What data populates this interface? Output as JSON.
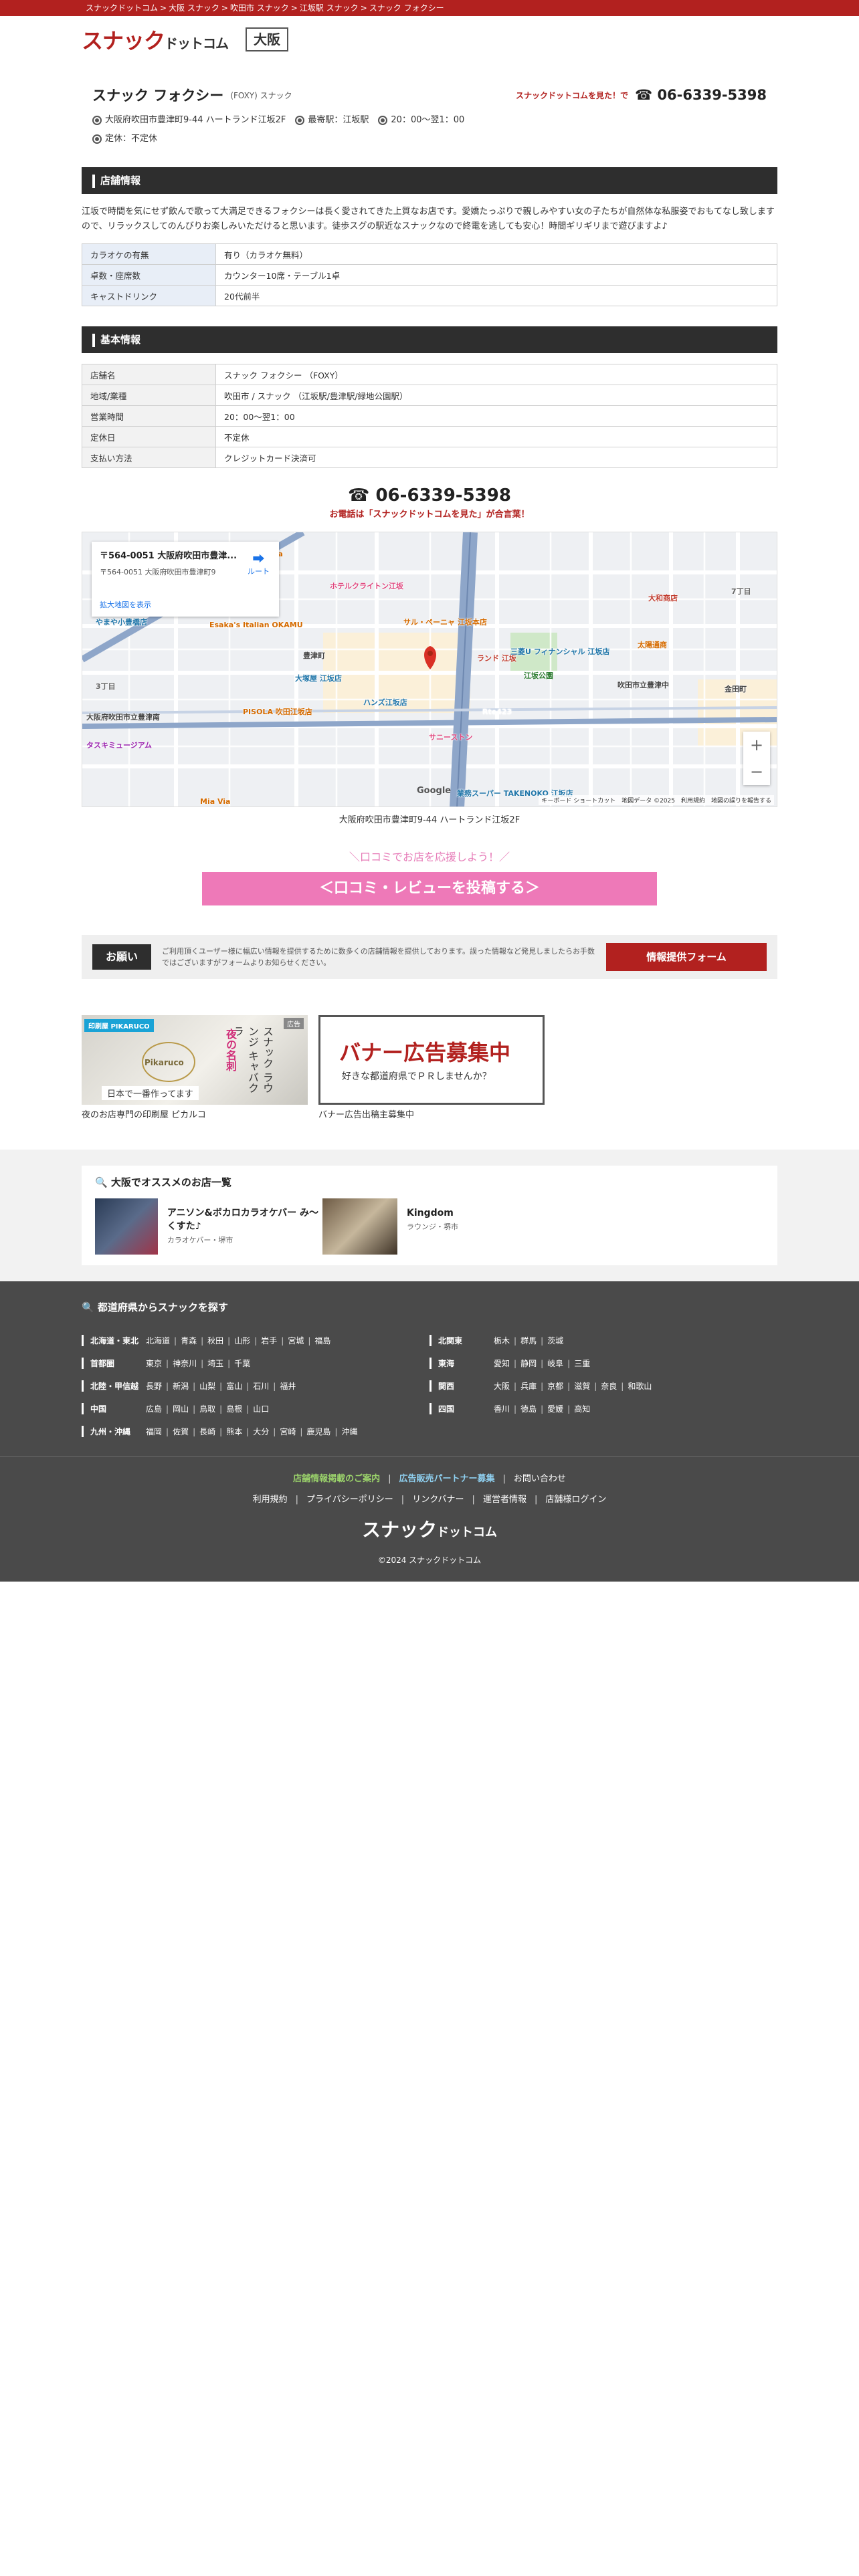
{
  "breadcrumb": [
    "スナックドットコム",
    "大阪 スナック",
    "吹田市 スナック",
    "江坂駅 スナック",
    "スナック フォクシー"
  ],
  "breadcrumb_sep": ">",
  "header": {
    "logo_main": "スナック",
    "logo_sub": "ドットコム",
    "area": "大阪"
  },
  "shop": {
    "name": "スナック フォクシー",
    "sub": "(FOXY) スナック",
    "tel_note": "スナックドットコムを見た！で",
    "tel_icon": "☎",
    "tel": "06-6339-5398",
    "meta": [
      "大阪府吹田市豊津町9-44 ハートランド江坂2F",
      "最寄駅：江坂駅",
      "20：00〜翌1：00",
      "定休：不定休"
    ]
  },
  "store_info": {
    "title": "店舗情報",
    "description": "江坂で時間を気にせず飲んで歌って大満足できるフォクシーは長く愛されてきた上質なお店です。愛嬌たっぷりで親しみやすい女の子たちが自然体な私服姿でおもてなし致しますので、リラックスしてのんびりお楽しみいただけると思います。徒歩スグの駅近なスナックなので終電を逃しても安心！時間ギリギリまで遊びますよ♪",
    "rows": [
      {
        "k": "カラオケの有無",
        "v": "有り（カラオケ無料）"
      },
      {
        "k": "卓数・座席数",
        "v": "カウンター10席・テーブル1卓"
      },
      {
        "k": "キャストドリンク",
        "v": "20代前半"
      }
    ]
  },
  "basic_info": {
    "title": "基本情報",
    "rows": [
      {
        "k": "店舗名",
        "v": "スナック フォクシー （FOXY）"
      },
      {
        "k": "地域/業種",
        "v": "吹田市 / スナック （江坂駅/豊津駅/緑地公園駅）"
      },
      {
        "k": "営業時間",
        "v": "20：00〜翌1：00"
      },
      {
        "k": "定休日",
        "v": "不定休"
      },
      {
        "k": "支払い方法",
        "v": "クレジットカード決済可"
      }
    ]
  },
  "big_tel": {
    "icon": "☎",
    "number": "06-6339-5398",
    "note": "お電話は「スナックドットコムを見た」が合言葉！"
  },
  "map": {
    "card_title": "〒564-0051 大阪府吹田市豊津...",
    "card_address": "〒564-0051 大阪府吹田市豊津町9",
    "card_link": "拡大地図を表示",
    "route": "ルート",
    "zoom_in": "+",
    "zoom_out": "−",
    "google": "Google",
    "footer": "キーボード ショートカット　地図データ ©2025　利用規約　地図の誤りを報告する",
    "labels": [
      {
        "t": "ホテルクライトン江坂",
        "c": "#e0487f"
      },
      {
        "t": "こば Bigpota",
        "c": "#d56b00"
      },
      {
        "t": "Esaka's Italian OKAMU",
        "c": "#d56b00"
      },
      {
        "t": "サル・ペーニャ 江坂本店",
        "c": "#d56b00"
      },
      {
        "t": "大和商店",
        "c": "#c0392b"
      },
      {
        "t": "豊津町",
        "c": "#444"
      },
      {
        "t": "大塚屋 江坂店",
        "c": "#2277aa"
      },
      {
        "t": "ハンズ江坂店",
        "c": "#2277aa"
      },
      {
        "t": "江坂公園",
        "c": "#2e7d32"
      },
      {
        "t": "PISOLA 吹田江坂店",
        "c": "#d56b00"
      },
      {
        "t": "サニーストン",
        "c": "#e0487f"
      },
      {
        "t": "吹田市立豊津中",
        "c": "#444"
      },
      {
        "t": "金田町",
        "c": "#444"
      },
      {
        "t": "業務スーパー TAKENOKO 江坂店",
        "c": "#2277aa"
      },
      {
        "t": "大阪府吹田市立豊津南",
        "c": "#444"
      },
      {
        "t": "タスキミュージアム",
        "c": "#9c27b0"
      },
      {
        "t": "Mia Via",
        "c": "#d56b00"
      },
      {
        "t": "小豊橋",
        "c": "#444"
      },
      {
        "t": "やまや小豊橋店",
        "c": "#2277aa"
      },
      {
        "t": "3丁目",
        "c": "#666"
      },
      {
        "t": "7丁目",
        "c": "#666"
      },
      {
        "t": "ランド 江坂",
        "c": "#c0392b"
      },
      {
        "t": "Rte423",
        "c": "#fff"
      },
      {
        "t": "三菱U フィナンシャル 江坂店",
        "c": "#2277aa"
      },
      {
        "t": "太陽通商",
        "c": "#d56b00"
      }
    ],
    "caption": "大阪府吹田市豊津町9-44 ハートランド江坂2F"
  },
  "review": {
    "note": "＼口コミでお店を応援しよう！／",
    "button": "＜口コミ・レビューを投稿する＞"
  },
  "inquiry": {
    "label": "お願い",
    "text": "ご利用頂くユーザー様に幅広い情報を提供するために数多くの店舗情報を提供しております。誤った情報など発見しましたらお手数ではございますがフォームよりお知らせください。",
    "button": "情報提供フォーム"
  },
  "banners": [
    {
      "caption": "夜のお店専門の印刷屋 ピカルコ",
      "tag": "広告",
      "logo": "印刷屋 PIKARUCO",
      "text_v": "スナック ラウンジ キャバクラ",
      "text_v2": "夜の名刺",
      "sub": "日本で一番作ってます",
      "brand": "Pikaruco"
    },
    {
      "caption": "バナー広告出稿主募集中",
      "title": "バナー広告募集中",
      "sub": "好きな都道府県でＰＲしませんか？"
    }
  ],
  "recommend": {
    "title": "大阪でオススメのお店一覧",
    "items": [
      {
        "name": "アニソン&ボカロカラオケバー み～くすた♪",
        "cat": "カラオケバー・堺市"
      },
      {
        "name": "Kingdom",
        "cat": "ラウンジ・堺市"
      }
    ]
  },
  "footer": {
    "title": "都道府県からスナックを探す",
    "left": [
      {
        "r": "北海道・東北",
        "p": [
          "北海道",
          "青森",
          "秋田",
          "山形",
          "岩手",
          "宮城",
          "福島"
        ]
      },
      {
        "r": "首都圏",
        "p": [
          "東京",
          "神奈川",
          "埼玉",
          "千葉"
        ]
      },
      {
        "r": "北陸・甲信越",
        "p": [
          "長野",
          "新潟",
          "山梨",
          "富山",
          "石川",
          "福井"
        ]
      },
      {
        "r": "中国",
        "p": [
          "広島",
          "岡山",
          "鳥取",
          "島根",
          "山口"
        ]
      },
      {
        "r": "九州・沖縄",
        "p": [
          "福岡",
          "佐賀",
          "長崎",
          "熊本",
          "大分",
          "宮崎",
          "鹿児島",
          "沖縄"
        ]
      }
    ],
    "right": [
      {
        "r": "北関東",
        "p": [
          "栃木",
          "群馬",
          "茨城"
        ]
      },
      {
        "r": "東海",
        "p": [
          "愛知",
          "静岡",
          "岐阜",
          "三重"
        ]
      },
      {
        "r": "関西",
        "p": [
          "大阪",
          "兵庫",
          "京都",
          "滋賀",
          "奈良",
          "和歌山"
        ]
      },
      {
        "r": "四国",
        "p": [
          "香川",
          "徳島",
          "愛媛",
          "高知"
        ]
      }
    ],
    "links1": [
      {
        "t": "店舗情報掲載のご案内",
        "c": "g"
      },
      {
        "t": "広告販売パートナー募集",
        "c": "b"
      },
      {
        "t": "お問い合わせ",
        "c": "w"
      }
    ],
    "links2": [
      "利用規約",
      "プライバシーポリシー",
      "リンクバナー",
      "運営者情報",
      "店舗様ログイン"
    ],
    "logo_main": "スナック",
    "logo_sub": "ドットコム",
    "copyright": "©2024 スナックドットコム"
  },
  "colors": {
    "brand": "#b2211f",
    "pink": "#ee79b8",
    "dark": "#2e2e2e",
    "footer": "#4a4a4a"
  }
}
